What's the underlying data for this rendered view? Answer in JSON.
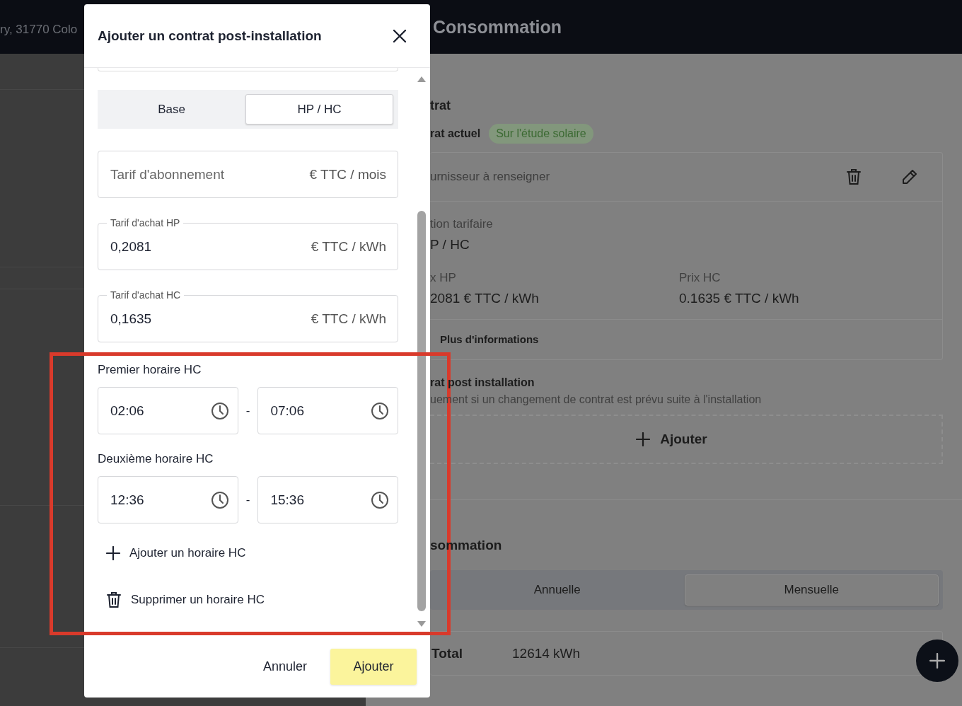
{
  "header": {
    "address": "ry, 31770 Colo",
    "title": "Consommation"
  },
  "contract": {
    "heading": "trat",
    "current_label": "rat actuel",
    "badge": "Sur l'étude solaire",
    "supplier": "urnisseur à renseigner",
    "option_label": "tion tarifaire",
    "option_value": "P / HC",
    "prices": [
      {
        "label": "x HP",
        "value": "2081 € TTC / kWh"
      },
      {
        "label": "Prix HC",
        "value": "0.1635 € TTC / kWh"
      }
    ],
    "more_info": "Plus d'informations",
    "post_title": "rat post installation",
    "post_hint": "uement si un changement de contrat est prévu suite à l'installation",
    "add_button": "Ajouter"
  },
  "consumption": {
    "heading": "sommation",
    "tabs": [
      {
        "label": "Annuelle",
        "selected": false
      },
      {
        "label": "Mensuelle",
        "selected": true
      }
    ],
    "total_label": "Total",
    "total_value": "12614 kWh"
  },
  "modal": {
    "title": "Ajouter un contrat post-installation",
    "tabs": [
      {
        "label": "Base",
        "selected": false
      },
      {
        "label": "HP / HC",
        "selected": true
      }
    ],
    "fields": [
      {
        "placeholder": "Tarif d'abonnement",
        "unit": "€ TTC / mois"
      },
      {
        "label": "Tarif d'achat HP",
        "value": "0,2081",
        "unit": "€ TTC / kWh"
      },
      {
        "label": "Tarif d'achat HC",
        "value": "0,1635",
        "unit": "€ TTC / kWh"
      }
    ],
    "schedules": [
      {
        "label": "Premier horaire HC",
        "start": "02:06",
        "separator": "-",
        "end": "07:06"
      },
      {
        "label": "Deuxième horaire HC",
        "start": "12:36",
        "separator": "-",
        "end": "15:36"
      }
    ],
    "add_schedule": "Ajouter un horaire HC",
    "remove_schedule": "Supprimer un horaire HC",
    "cancel": "Annuler",
    "submit": "Ajouter"
  }
}
